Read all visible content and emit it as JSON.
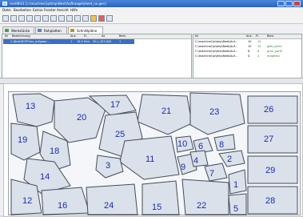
{
  "window": {
    "title": "nestWin1 [c:\\machine\\1p\\tmp\\Nest\\Auftraege\\sheet_no.gen]",
    "buttons": [
      "minimize-button",
      "maximize-button",
      "close-button"
    ]
  },
  "menu": [
    "Datei",
    "Bearbeiten",
    "Extras",
    "Fenster",
    "Ansicht",
    "Hilfe"
  ],
  "toolbar": {
    "icons": [
      "new-icon",
      "open-icon",
      "save-icon",
      "print-icon",
      "cut-icon",
      "copy-icon",
      "paste-icon",
      "undo-icon",
      "redo-icon",
      "zoom-icon",
      "grid-icon",
      "nest-icon",
      "settings-icon",
      "help-icon"
    ]
  },
  "tabs": [
    "Werkstücke",
    "Rohplatten",
    "Schnittpläne"
  ],
  "left_table": {
    "columns": [
      "Nr",
      "Bezeichnung",
      "Anz.",
      "Fl.",
      "dx",
      "Bem."
    ],
    "selected_row": [
      "",
      "C:\\Nest\\ROPlGen_aufgabe...",
      "1",
      "78,9 Stck",
      "50,1,453,000",
      "1"
    ]
  },
  "right_table": {
    "columns": [
      "Nr",
      "Anz.",
      "Fl.",
      "Bem."
    ],
    "rows": [
      {
        "name": "C:\\machine\\1p\\tmp\\Nest\\Auf...",
        "a": "10",
        "b": "10",
        "c": "",
        "color": "#2e7d32"
      },
      {
        "name": "C:\\machine\\1p\\tmp\\Nest\\Auf...",
        "a": "10",
        "b": "10",
        "c": "gelb_part1",
        "color": "#2e7d32"
      },
      {
        "name": "C:\\machine\\1p\\tmp\\Nest\\Auf...",
        "a": "6",
        "b": "6",
        "c": "grün_part3",
        "color": "#2e7d32"
      },
      {
        "name": "C:\\machine\\1p\\tmp\\Nest\\Auf...",
        "a": "4",
        "b": "4",
        "c": "magenta",
        "color": "#2e7d32"
      }
    ]
  },
  "parts": [
    "13",
    "17",
    "21",
    "23",
    "26",
    "20",
    "19",
    "25",
    "10",
    "6",
    "8",
    "27",
    "18",
    "11",
    "3",
    "9",
    "4",
    "7",
    "2",
    "14",
    "1",
    "29",
    "12",
    "16",
    "24",
    "15",
    "22",
    "5",
    "28"
  ]
}
